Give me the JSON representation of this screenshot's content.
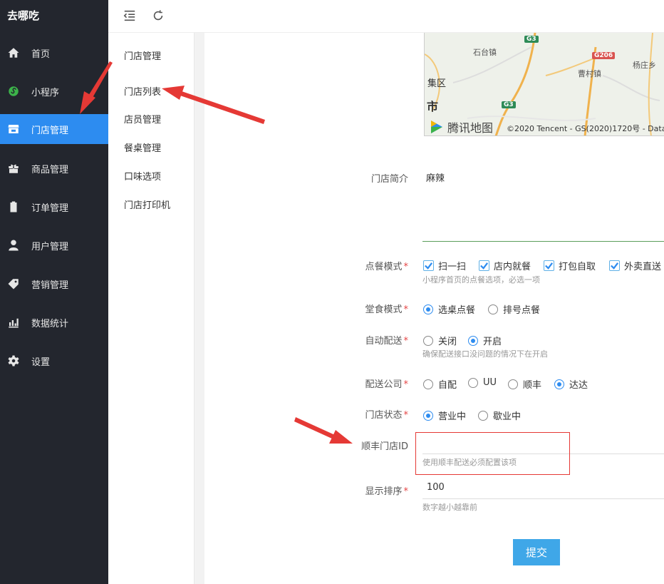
{
  "brand": "去哪吃",
  "sidebar": {
    "items": [
      {
        "label": "首页",
        "icon": "home-icon"
      },
      {
        "label": "小程序",
        "icon": "mini-program-icon"
      },
      {
        "label": "门店管理",
        "icon": "store-icon"
      },
      {
        "label": "商品管理",
        "icon": "gift-icon"
      },
      {
        "label": "订单管理",
        "icon": "clipboard-icon"
      },
      {
        "label": "用户管理",
        "icon": "user-icon"
      },
      {
        "label": "营销管理",
        "icon": "tag-icon"
      },
      {
        "label": "数据统计",
        "icon": "bar-chart-icon"
      },
      {
        "label": "设置",
        "icon": "gear-icon"
      }
    ],
    "active": "门店管理"
  },
  "topbar": {
    "icons": [
      "menu-fold-icon",
      "refresh-icon"
    ]
  },
  "submenu": {
    "title": "门店管理",
    "items": [
      "门店列表",
      "店员管理",
      "餐桌管理",
      "口味选项",
      "门店打印机"
    ]
  },
  "map": {
    "places": [
      "石台镇",
      "曹村镇",
      "杨庄乡",
      "集区"
    ],
    "city": "市",
    "shields": [
      "G3",
      "G206",
      "G3"
    ],
    "logo_text": "腾讯地图",
    "copyright": "©2020 Tencent - GS(2020)1720号 - Data"
  },
  "form": {
    "intro_label": "门店简介",
    "intro_value": "麻辣",
    "order_mode_label": "点餐模式",
    "order_mode_options": [
      "扫一扫",
      "店内就餐",
      "打包自取",
      "外卖直送"
    ],
    "order_mode_hint": "小程序首页的点餐选项，必选一项",
    "dine_mode_label": "堂食模式",
    "dine_mode_options": [
      "选桌点餐",
      "排号点餐"
    ],
    "dine_mode_selected": "选桌点餐",
    "auto_delivery_label": "自动配送",
    "auto_delivery_options": [
      "关闭",
      "开启"
    ],
    "auto_delivery_selected": "开启",
    "auto_delivery_hint": "确保配送接口没问题的情况下在开启",
    "delivery_company_label": "配送公司",
    "delivery_company_options": [
      "自配",
      "UU",
      "顺丰",
      "达达"
    ],
    "delivery_company_selected": "达达",
    "store_status_label": "门店状态",
    "store_status_options": [
      "营业中",
      "歇业中"
    ],
    "store_status_selected": "营业中",
    "sf_store_id_label": "顺丰门店ID",
    "sf_store_id_value": "",
    "sf_store_id_hint": "使用顺丰配送必须配置该项",
    "sort_label": "显示排序",
    "sort_value": "100",
    "sort_hint": "数字越小越靠前",
    "submit_label": "提交",
    "required_mark": "*"
  },
  "colors": {
    "sidebar_bg": "#23262e",
    "active_bg": "#2d8cf0",
    "accent": "#2d8cf0",
    "submit_bg": "#3fa7e8",
    "annotation_red": "#e53935"
  }
}
